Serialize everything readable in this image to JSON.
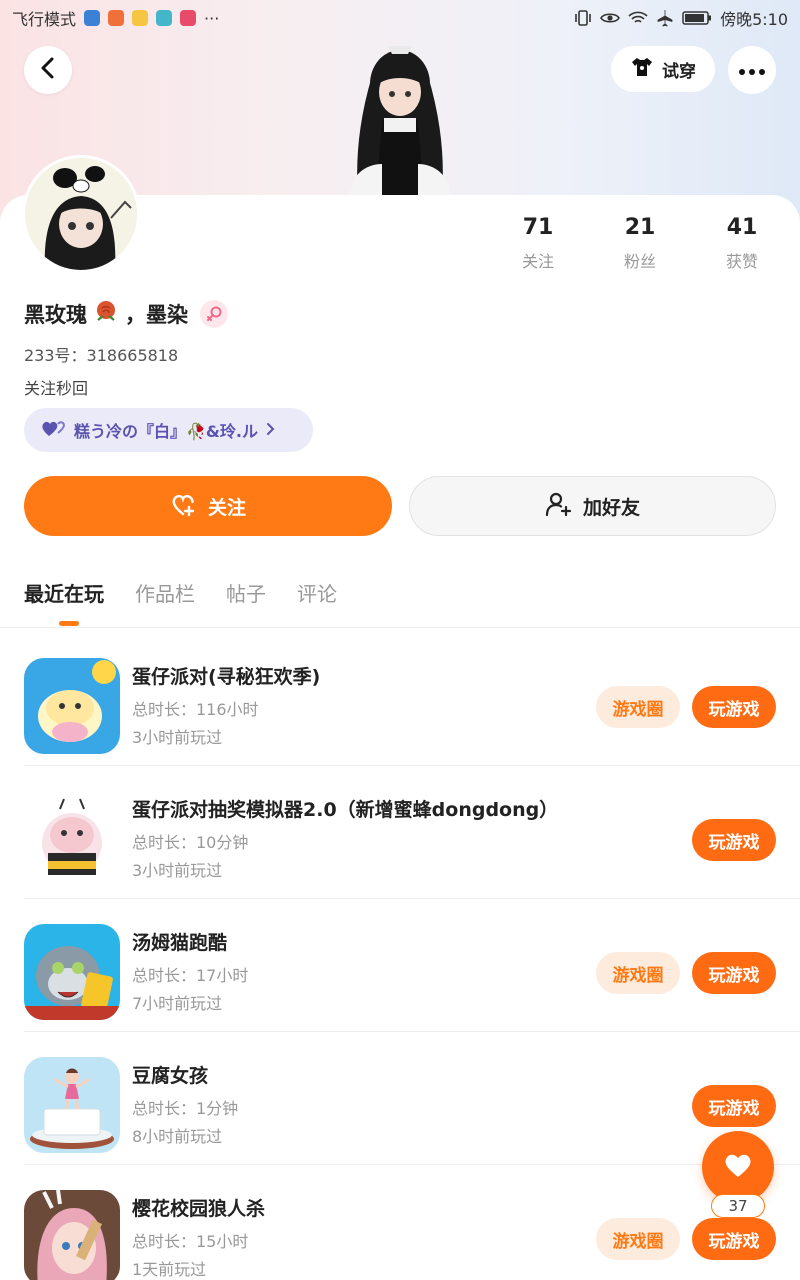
{
  "status_bar": {
    "left_text": "飞行模式",
    "ellipsis": "···",
    "right_time": "傍晚5:10"
  },
  "header": {
    "tryon_label": "试穿"
  },
  "profile": {
    "stats": [
      {
        "value": "71",
        "label": "关注"
      },
      {
        "value": "21",
        "label": "粉丝"
      },
      {
        "value": "41",
        "label": "获赞"
      }
    ],
    "name_part1": "黑玫瑰",
    "name_part2": "，墨染",
    "uid": "233号：318665818",
    "bio": "关注秒回",
    "cp_badge": "糕う冷の『白』🥀&玲.ル"
  },
  "actions": {
    "follow_label": "关注",
    "add_friend_label": "加好友"
  },
  "tabs": [
    {
      "label": "最近在玩"
    },
    {
      "label": "作品栏"
    },
    {
      "label": "帖子"
    },
    {
      "label": "评论"
    }
  ],
  "games": [
    {
      "title": "蛋仔派对(寻秘狂欢季)",
      "duration": "总时长：116小时",
      "last_played": "3小时前玩过",
      "circle": "游戏圈",
      "play": "玩游戏"
    },
    {
      "title": "蛋仔派对抽奖模拟器2.0（新增蜜蜂dongdong）",
      "duration": "总时长：10分钟",
      "last_played": "3小时前玩过",
      "circle": "",
      "play": "玩游戏"
    },
    {
      "title": "汤姆猫跑酷",
      "duration": "总时长：17小时",
      "last_played": "7小时前玩过",
      "circle": "游戏圈",
      "play": "玩游戏"
    },
    {
      "title": "豆腐女孩",
      "duration": "总时长：1分钟",
      "last_played": "8小时前玩过",
      "circle": "",
      "play": "玩游戏"
    },
    {
      "title": "樱花校园狼人杀",
      "duration": "总时长：15小时",
      "last_played": "1天前玩过",
      "circle": "游戏圈",
      "play": "玩游戏"
    }
  ],
  "fab": {
    "count": "37"
  },
  "colors": {
    "accent": "#ff7a14",
    "badge_bg": "#ebeaf9",
    "badge_text": "#5b53b0"
  }
}
